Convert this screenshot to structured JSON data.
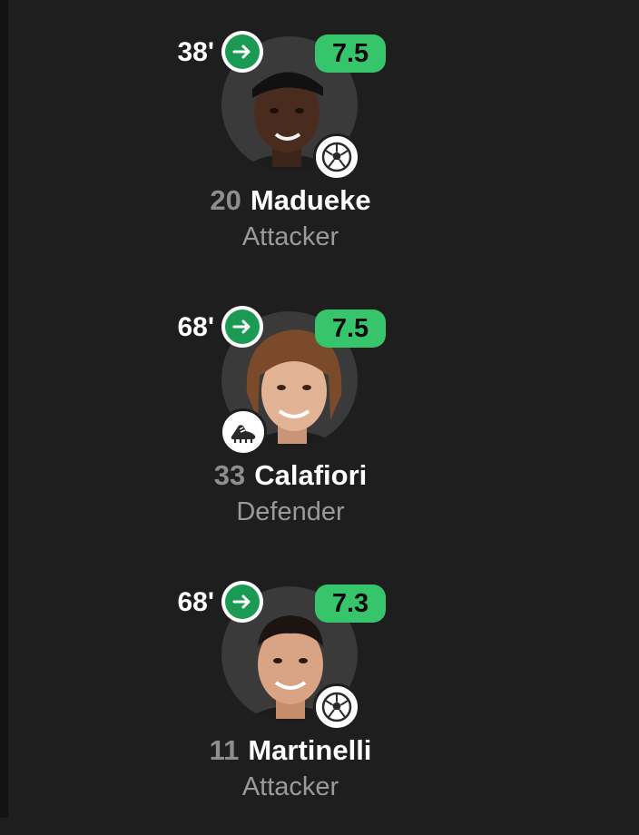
{
  "players": [
    {
      "sub_minute": "38'",
      "rating": "7.5",
      "number": "20",
      "name": "Madueke",
      "position": "Attacker",
      "event_icon": "soccer-ball-icon"
    },
    {
      "sub_minute": "68'",
      "rating": "7.5",
      "number": "33",
      "name": "Calafiori",
      "position": "Defender",
      "event_icon": "football-boot-icon"
    },
    {
      "sub_minute": "68'",
      "rating": "7.3",
      "number": "11",
      "name": "Martinelli",
      "position": "Attacker",
      "event_icon": "soccer-ball-icon"
    }
  ],
  "colors": {
    "background": "#1e1e1e",
    "rating_badge": "#36c56a",
    "sub_arrow": "#1a9a52"
  }
}
